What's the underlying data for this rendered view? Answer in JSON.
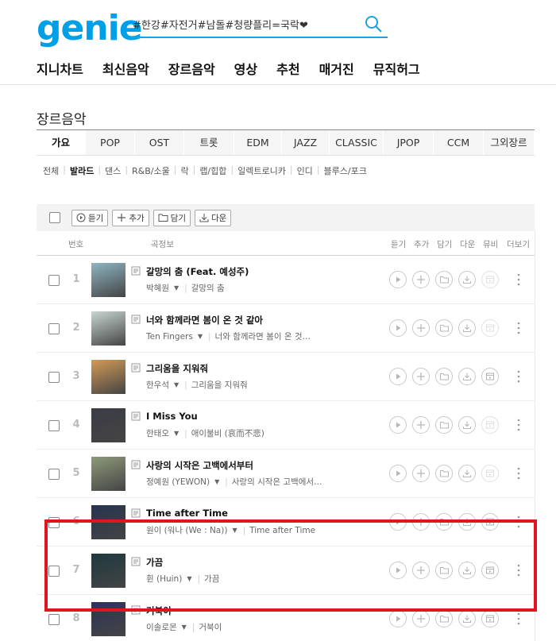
{
  "header": {
    "logo": "genie",
    "search_value": "#한강#자전거#남돌#청량플리=국락❤",
    "nav": [
      "지니차트",
      "최신음악",
      "장르음악",
      "영상",
      "추천",
      "매거진",
      "뮤직허그"
    ]
  },
  "page_title": "장르음악",
  "tabs": [
    "가요",
    "POP",
    "OST",
    "트롯",
    "EDM",
    "JAZZ",
    "CLASSIC",
    "JPOP",
    "CCM",
    "그외장르"
  ],
  "active_tab": 0,
  "subgenres": [
    "전체",
    "발라드",
    "댄스",
    "R&B/소울",
    "락",
    "랩/힙합",
    "일렉트로니카",
    "인디",
    "블루스/포크"
  ],
  "active_subgenre": 1,
  "toolbar": {
    "play": "듣기",
    "add": "추가",
    "save": "담기",
    "download": "다운"
  },
  "columns": {
    "num": "번호",
    "info": "곡정보",
    "listen": "듣기",
    "add": "추가",
    "save": "담기",
    "down": "다운",
    "mv": "뮤비",
    "more": "더보기"
  },
  "songs": [
    {
      "num": "1",
      "title": "갈망의 춤 (Feat. 예성주)",
      "artist": "박혜원",
      "album": "갈망의 춤",
      "mv": false,
      "thumb": "#8fb5c4"
    },
    {
      "num": "2",
      "title": "너와 함께라면 봄이 온 것 같아",
      "artist": "Ten Fingers",
      "album": "너와 함께라면 봄이 온 것…",
      "mv": false,
      "thumb": "#c9d6d2"
    },
    {
      "num": "3",
      "title": "그리움을 지워줘",
      "artist": "한우석",
      "album": "그리움을 지워줘",
      "mv": true,
      "thumb": "#d49a56"
    },
    {
      "num": "4",
      "title": "I Miss You",
      "artist": "한태오",
      "album": "애이불비 (哀而不悲)",
      "mv": false,
      "thumb": "#3b3c46"
    },
    {
      "num": "5",
      "title": "사랑의 시작은 고백에서부터",
      "artist": "정예원 (YEWON)",
      "album": "사랑의 시작은 고백에서…",
      "mv": false,
      "thumb": "#8e9a7a"
    },
    {
      "num": "6",
      "title": "Time after Time",
      "artist": "원이 (워나 (We : Na))",
      "album": "Time after Time",
      "mv": true,
      "thumb": "#26344f"
    },
    {
      "num": "7",
      "title": "가끔",
      "artist": "휜 (Huin)",
      "album": "가끔",
      "mv": true,
      "thumb": "#1d3940"
    },
    {
      "num": "8",
      "title": "거북이",
      "artist": "이솔로몬",
      "album": "거북이",
      "mv": true,
      "thumb": "#2c3359"
    }
  ],
  "colors": {
    "brand": "#00a0e9",
    "highlight": "#e0151d"
  }
}
